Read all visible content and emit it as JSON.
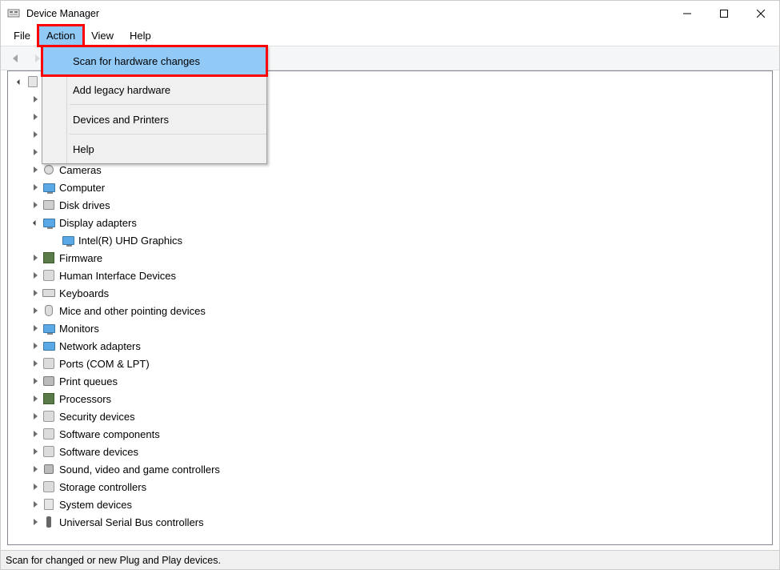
{
  "window": {
    "title": "Device Manager"
  },
  "menubar": {
    "file": "File",
    "action": "Action",
    "view": "View",
    "help": "Help"
  },
  "action_menu": {
    "scan": "Scan for hardware changes",
    "add_legacy": "Add legacy hardware",
    "devices_printers": "Devices and Printers",
    "help": "Help"
  },
  "tree": {
    "root": "",
    "items": [
      {
        "label": "",
        "level": 1,
        "expander": "closed"
      },
      {
        "label": "",
        "level": 1,
        "expander": "closed"
      },
      {
        "label": "",
        "level": 1,
        "expander": "closed"
      },
      {
        "label": "",
        "level": 1,
        "expander": "closed"
      },
      {
        "label": "Cameras",
        "level": 1,
        "expander": "closed",
        "icon": "cam"
      },
      {
        "label": "Computer",
        "level": 1,
        "expander": "closed",
        "icon": "monitor"
      },
      {
        "label": "Disk drives",
        "level": 1,
        "expander": "closed",
        "icon": "disk"
      },
      {
        "label": "Display adapters",
        "level": 1,
        "expander": "open",
        "icon": "monitor"
      },
      {
        "label": "Intel(R) UHD Graphics",
        "level": 2,
        "expander": "none",
        "icon": "monitor"
      },
      {
        "label": "Firmware",
        "level": 1,
        "expander": "closed",
        "icon": "chip"
      },
      {
        "label": "Human Interface Devices",
        "level": 1,
        "expander": "closed",
        "icon": "generic"
      },
      {
        "label": "Keyboards",
        "level": 1,
        "expander": "closed",
        "icon": "kb"
      },
      {
        "label": "Mice and other pointing devices",
        "level": 1,
        "expander": "closed",
        "icon": "mouse"
      },
      {
        "label": "Monitors",
        "level": 1,
        "expander": "closed",
        "icon": "monitor"
      },
      {
        "label": "Network adapters",
        "level": 1,
        "expander": "closed",
        "icon": "net"
      },
      {
        "label": "Ports (COM & LPT)",
        "level": 1,
        "expander": "closed",
        "icon": "generic"
      },
      {
        "label": "Print queues",
        "level": 1,
        "expander": "closed",
        "icon": "print"
      },
      {
        "label": "Processors",
        "level": 1,
        "expander": "closed",
        "icon": "chip"
      },
      {
        "label": "Security devices",
        "level": 1,
        "expander": "closed",
        "icon": "generic"
      },
      {
        "label": "Software components",
        "level": 1,
        "expander": "closed",
        "icon": "generic"
      },
      {
        "label": "Software devices",
        "level": 1,
        "expander": "closed",
        "icon": "generic"
      },
      {
        "label": "Sound, video and game controllers",
        "level": 1,
        "expander": "closed",
        "icon": "sound"
      },
      {
        "label": "Storage controllers",
        "level": 1,
        "expander": "closed",
        "icon": "generic"
      },
      {
        "label": "System devices",
        "level": 1,
        "expander": "closed",
        "icon": "pc"
      },
      {
        "label": "Universal Serial Bus controllers",
        "level": 1,
        "expander": "closed",
        "icon": "usb"
      }
    ]
  },
  "status": "Scan for changed or new Plug and Play devices.",
  "highlight": {
    "color": "#ff0000"
  }
}
